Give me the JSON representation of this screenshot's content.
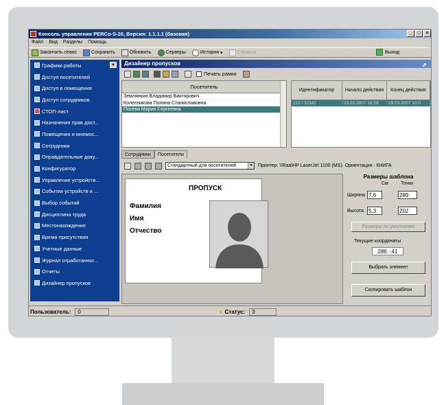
{
  "window": {
    "title": "Консоль управления PERCo-S-20, Версия: 1.1.1.1 (базовая)",
    "controls": [
      "_",
      "□",
      "×"
    ]
  },
  "menu": [
    "Файл",
    "Вид",
    "Разделы",
    "Помощь"
  ],
  "toolbar": {
    "end_session": "Закончить сеанс",
    "save": "Сохранить",
    "refresh": "Обновить",
    "servers": "Серверы",
    "history": "История",
    "help": "Справка",
    "exit": "Выход"
  },
  "sidebar": {
    "items": [
      "Графики работы",
      "Доступ посетителей",
      "Доступ в помещения",
      "Доступ сотрудников",
      "СТОП-лист",
      "Назначения прав дост...",
      "Помещения и мнемос...",
      "Сотрудники",
      "Оправдательные доку...",
      "Конфигуратор",
      "Управление устройств...",
      "События устройств и ...",
      "Выбор событий",
      "Дисциплина труда",
      "Местонахождение",
      "Время присутствия",
      "Учетные данные",
      "Журнал отработанног...",
      "Отчеты",
      "Дизайнер пропусков"
    ]
  },
  "header": {
    "title": "Дизайнер пропусков"
  },
  "print_frames_label": "Печать рамки",
  "visitors": {
    "header": "Посетитель",
    "rows": [
      "Землянкин Владимир Викторович",
      "Колесникова Полина Станиславовна",
      "Посева Мария Сергеевна"
    ]
  },
  "access": {
    "headers": [
      "Идентификатор",
      "Начало действия",
      "Конец действия"
    ],
    "rows": [
      [
        "112 / 32342",
        "23.03.2007 16:59",
        "29.03.2007 10:0"
      ]
    ]
  },
  "tabs": [
    "Сотрудники",
    "Посетители"
  ],
  "designer": {
    "template_select": "Стандартный для посетителей",
    "printer": "Принтер: \\\\Raa\\HP LaserJet 1100 (MS). Ориентация - КНИГА"
  },
  "pass": {
    "title": "ПРОПУСК",
    "fields": [
      "Фамилия",
      "Имя",
      "Отчество"
    ]
  },
  "template_size": {
    "title": "Размеры шаблона",
    "col_cm": "См",
    "col_points": "Точки",
    "width_label": "Ширина",
    "width_cm": "7,6",
    "width_pt": "289",
    "height_label": "Высота",
    "height_cm": "5,3",
    "height_pt": "202",
    "default_btn": "Размеры по умолчанию",
    "coords_label": "Текущие координаты",
    "coords_value": "286 : 41",
    "select_btn": "Выбрать элемент",
    "copy_btn": "Скопировать шаблон"
  },
  "status": {
    "user_label": "Пользователь:",
    "user_value": "0",
    "status_label": "Статус:",
    "status_value": "3"
  }
}
